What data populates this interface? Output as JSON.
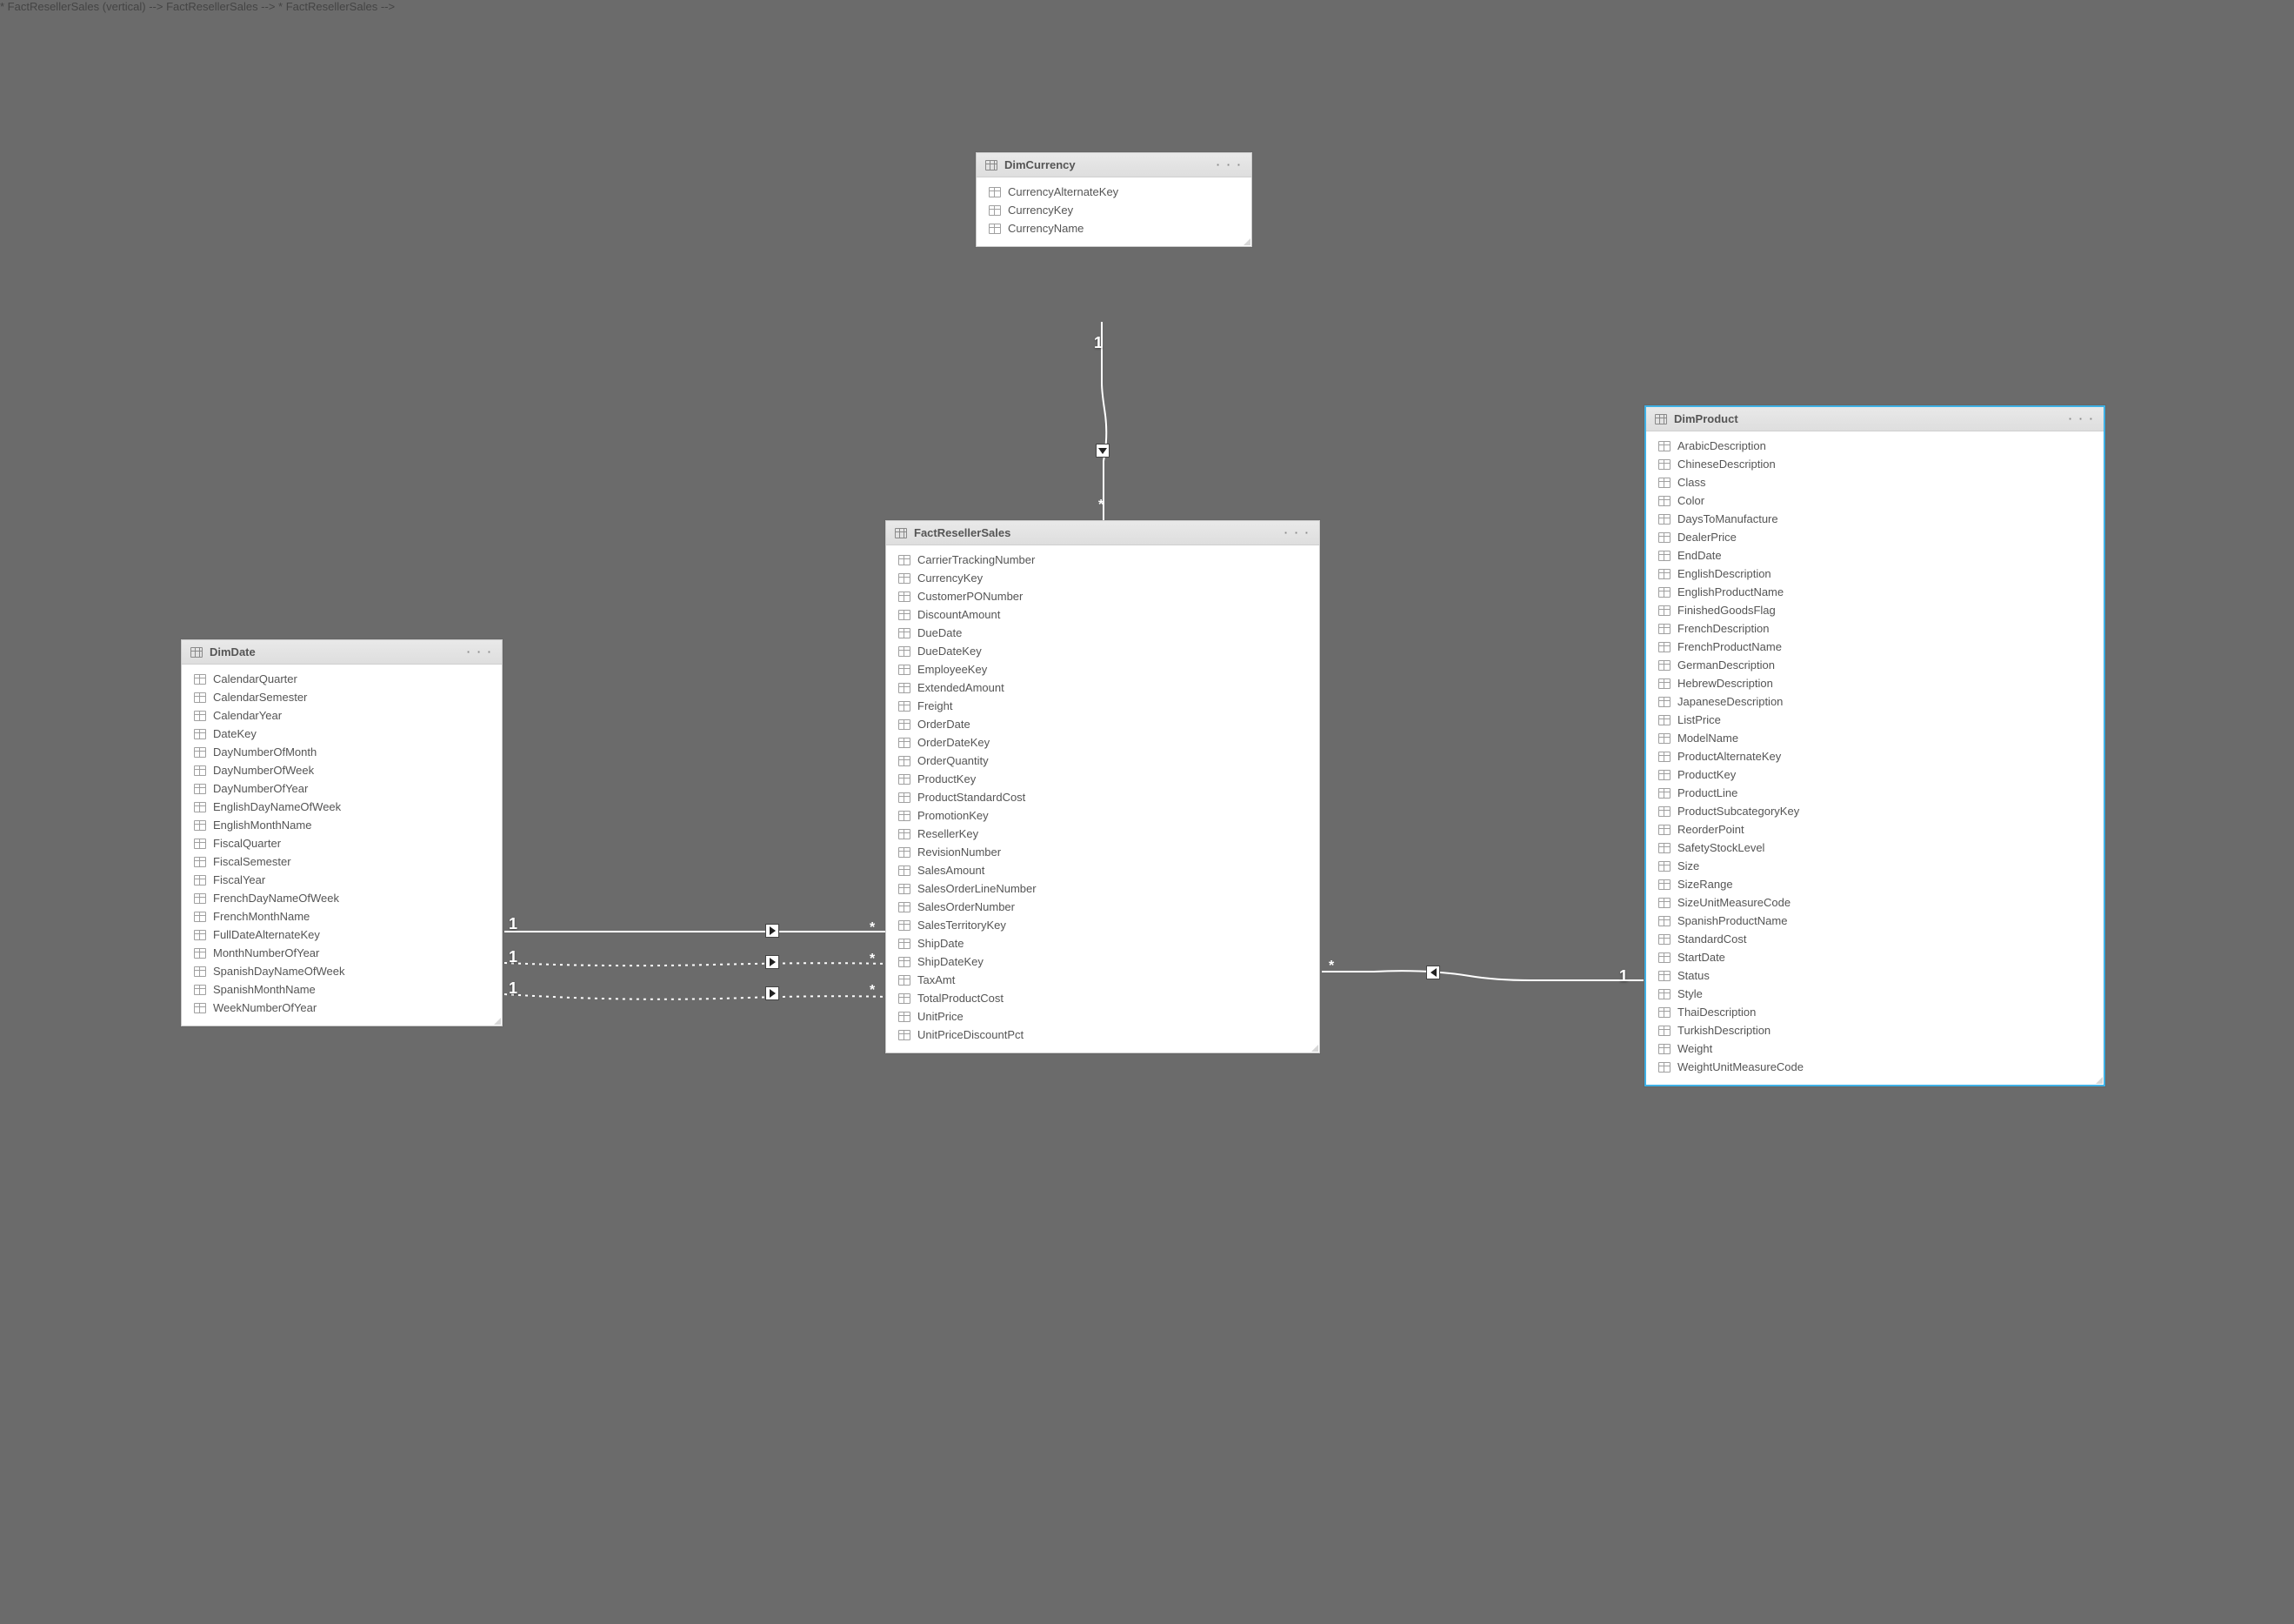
{
  "tables": {
    "dimCurrency": {
      "title": "DimCurrency",
      "fields": [
        "CurrencyAlternateKey",
        "CurrencyKey",
        "CurrencyName"
      ]
    },
    "factResellerSales": {
      "title": "FactResellerSales",
      "fields": [
        "CarrierTrackingNumber",
        "CurrencyKey",
        "CustomerPONumber",
        "DiscountAmount",
        "DueDate",
        "DueDateKey",
        "EmployeeKey",
        "ExtendedAmount",
        "Freight",
        "OrderDate",
        "OrderDateKey",
        "OrderQuantity",
        "ProductKey",
        "ProductStandardCost",
        "PromotionKey",
        "ResellerKey",
        "RevisionNumber",
        "SalesAmount",
        "SalesOrderLineNumber",
        "SalesOrderNumber",
        "SalesTerritoryKey",
        "ShipDate",
        "ShipDateKey",
        "TaxAmt",
        "TotalProductCost",
        "UnitPrice",
        "UnitPriceDiscountPct"
      ]
    },
    "dimDate": {
      "title": "DimDate",
      "fields": [
        "CalendarQuarter",
        "CalendarSemester",
        "CalendarYear",
        "DateKey",
        "DayNumberOfMonth",
        "DayNumberOfWeek",
        "DayNumberOfYear",
        "EnglishDayNameOfWeek",
        "EnglishMonthName",
        "FiscalQuarter",
        "FiscalSemester",
        "FiscalYear",
        "FrenchDayNameOfWeek",
        "FrenchMonthName",
        "FullDateAlternateKey",
        "MonthNumberOfYear",
        "SpanishDayNameOfWeek",
        "SpanishMonthName",
        "WeekNumberOfYear"
      ]
    },
    "dimProduct": {
      "title": "DimProduct",
      "fields": [
        "ArabicDescription",
        "ChineseDescription",
        "Class",
        "Color",
        "DaysToManufacture",
        "DealerPrice",
        "EndDate",
        "EnglishDescription",
        "EnglishProductName",
        "FinishedGoodsFlag",
        "FrenchDescription",
        "FrenchProductName",
        "GermanDescription",
        "HebrewDescription",
        "JapaneseDescription",
        "ListPrice",
        "ModelName",
        "ProductAlternateKey",
        "ProductKey",
        "ProductLine",
        "ProductSubcategoryKey",
        "ReorderPoint",
        "SafetyStockLevel",
        "Size",
        "SizeRange",
        "SizeUnitMeasureCode",
        "SpanishProductName",
        "StandardCost",
        "StartDate",
        "Status",
        "Style",
        "ThaiDescription",
        "TurkishDescription",
        "Weight",
        "WeightUnitMeasureCode"
      ]
    }
  },
  "rel": {
    "one": "1",
    "many": "*",
    "ellipsis": "· · ·"
  }
}
